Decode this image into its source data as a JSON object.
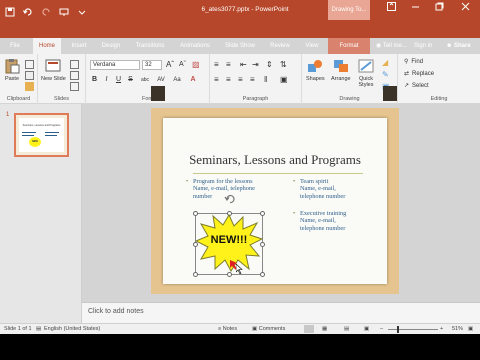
{
  "window": {
    "title": "6_ates3077.pptx - PowerPoint",
    "context_tab_group": "Drawing To...",
    "controls": [
      "minimize-icon",
      "restore-icon",
      "close-icon"
    ]
  },
  "qat": {
    "icons": [
      "save-icon",
      "undo-icon",
      "redo-icon",
      "slideshow-start-icon",
      "customize-icon"
    ]
  },
  "tabs": [
    {
      "label": "File"
    },
    {
      "label": "Home",
      "active": true
    },
    {
      "label": "Insert"
    },
    {
      "label": "Design"
    },
    {
      "label": "Transitions"
    },
    {
      "label": "Animations"
    },
    {
      "label": "Slide Show"
    },
    {
      "label": "Review"
    },
    {
      "label": "View"
    },
    {
      "label": "Format",
      "contextual": true
    }
  ],
  "tell_me": "Tell me...",
  "sign_in": "Sign in",
  "share": "Share",
  "ribbon": {
    "clipboard": {
      "paste": "Paste",
      "label": "Clipboard"
    },
    "slides": {
      "new_slide": "New Slide",
      "label": "Slides"
    },
    "font": {
      "name": "Verdana",
      "size": "32",
      "label": "Font",
      "buttons": [
        "B",
        "I",
        "U",
        "S",
        "abc",
        "AV",
        "Aa"
      ]
    },
    "paragraph": {
      "label": "Paragraph"
    },
    "drawing": {
      "shapes": "Shapes",
      "arrange": "Arrange",
      "quick_styles": "Quick Styles",
      "label": "Drawing"
    },
    "editing": {
      "find": "Find",
      "replace": "Replace",
      "select": "Select",
      "label": "Editing"
    }
  },
  "slides_pane": {
    "thumbnail_number": "1",
    "thumbnail_title": "Seminars, Lessons and Programs",
    "thumbnail_badge": "NEW"
  },
  "slide": {
    "title": "Seminars, Lessons and Programs",
    "left_bullet": {
      "lead": "Program for the lessons",
      "sub_line1": "Name, e-mail, telephone",
      "sub_line2": "number"
    },
    "right_bullet1": {
      "lead": "Team spirit",
      "sub_line1": "Name, e-mail,",
      "sub_line2": "telephone number"
    },
    "right_bullet2": {
      "lead": "Executive training",
      "sub_line1": "Name, e-mail,",
      "sub_line2": "telephone number"
    },
    "burst_text": "NEW!!!",
    "colors": {
      "frame": "#e6c48f",
      "paper": "#fafaf7",
      "text_blue": "#2e5f8a",
      "burst_fill": "#fff21a",
      "burst_edge": "#7d7d2c"
    }
  },
  "notes_placeholder": "Click to add notes",
  "status": {
    "slide_info": "Slide 1 of 1",
    "language": "English (United States)",
    "notes": "Notes",
    "comments": "Comments",
    "zoom": "51%"
  },
  "accent": "#b7472a"
}
